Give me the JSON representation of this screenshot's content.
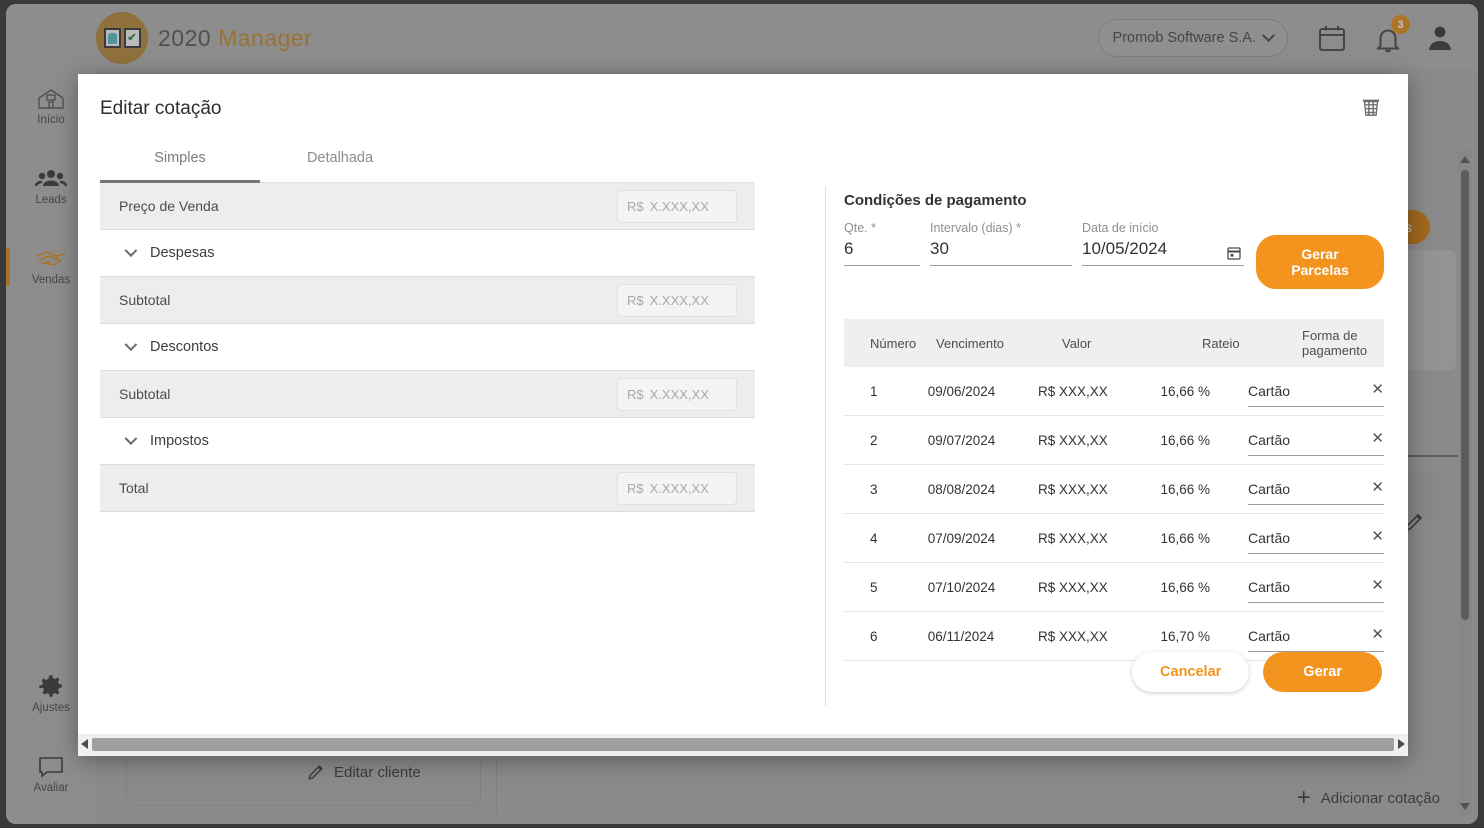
{
  "colors": {
    "accent": "#F2941E",
    "accent_dark": "#CC7D14",
    "logo_gold": "#B5883E",
    "text": "#333333"
  },
  "topbar": {
    "logo_text_1": "2020",
    "logo_text_2": "Manager",
    "company": "Promob Software S.A.",
    "icons": {
      "calendar": "calendar-icon",
      "bell": "bell-icon",
      "user": "user-icon"
    },
    "notification_count": "3"
  },
  "sidebar": {
    "items": [
      {
        "label": "Início",
        "icon": "home-icon",
        "active": false
      },
      {
        "label": "Leads",
        "icon": "people-icon",
        "active": false
      },
      {
        "label": "Vendas",
        "icon": "handshake-icon",
        "active": true
      },
      {
        "label": "Ajustes",
        "icon": "gear-icon",
        "active": false
      },
      {
        "label": "Avaliar",
        "icon": "chat-bubble-icon",
        "active": false
      }
    ]
  },
  "background": {
    "orange_button_partial": "tes",
    "edit_client": "Editar cliente",
    "add_quote": "Adicionar cotação"
  },
  "modal": {
    "title": "Editar cotação",
    "trash_icon": "trash-icon",
    "tabs": [
      {
        "label": "Simples",
        "active": true
      },
      {
        "label": "Detalhada",
        "active": false
      }
    ],
    "money_placeholder_currency": "R$",
    "money_placeholder_value": "X.XXX,XX",
    "rows": [
      {
        "type": "value",
        "label": "Preço de Venda"
      },
      {
        "type": "accordion",
        "label": "Despesas"
      },
      {
        "type": "value",
        "label": "Subtotal"
      },
      {
        "type": "accordion",
        "label": "Descontos"
      },
      {
        "type": "value",
        "label": "Subtotal"
      },
      {
        "type": "accordion",
        "label": "Impostos"
      },
      {
        "type": "value",
        "label": "Total"
      }
    ],
    "payment": {
      "title": "Condições de pagamento",
      "fields": [
        {
          "label": "Qte. *",
          "value": "6"
        },
        {
          "label": "Intervalo (dias) *",
          "value": "30"
        },
        {
          "label": "Data de início",
          "value": "10/05/2024"
        }
      ],
      "generate_button": "Gerar Parcelas",
      "calendar_icon": "calendar-icon",
      "columns": [
        "Número",
        "Vencimento",
        "Valor",
        "Rateio",
        "Forma de pagamento"
      ],
      "installments": [
        {
          "numero": "1",
          "vencimento": "09/06/2024",
          "valor": "R$ XXX,XX",
          "rateio": "16,66 %",
          "forma": "Cartão"
        },
        {
          "numero": "2",
          "vencimento": "09/07/2024",
          "valor": "R$ XXX,XX",
          "rateio": "16,66 %",
          "forma": "Cartão"
        },
        {
          "numero": "3",
          "vencimento": "08/08/2024",
          "valor": "R$ XXX,XX",
          "rateio": "16,66 %",
          "forma": "Cartão"
        },
        {
          "numero": "4",
          "vencimento": "07/09/2024",
          "valor": "R$ XXX,XX",
          "rateio": "16,66 %",
          "forma": "Cartão"
        },
        {
          "numero": "5",
          "vencimento": "07/10/2024",
          "valor": "R$ XXX,XX",
          "rateio": "16,66 %",
          "forma": "Cartão"
        },
        {
          "numero": "6",
          "vencimento": "06/11/2024",
          "valor": "R$ XXX,XX",
          "rateio": "16,70 %",
          "forma": "Cartão"
        }
      ],
      "remove_label": "✕"
    },
    "actions": {
      "cancel": "Cancelar",
      "confirm": "Gerar"
    }
  }
}
